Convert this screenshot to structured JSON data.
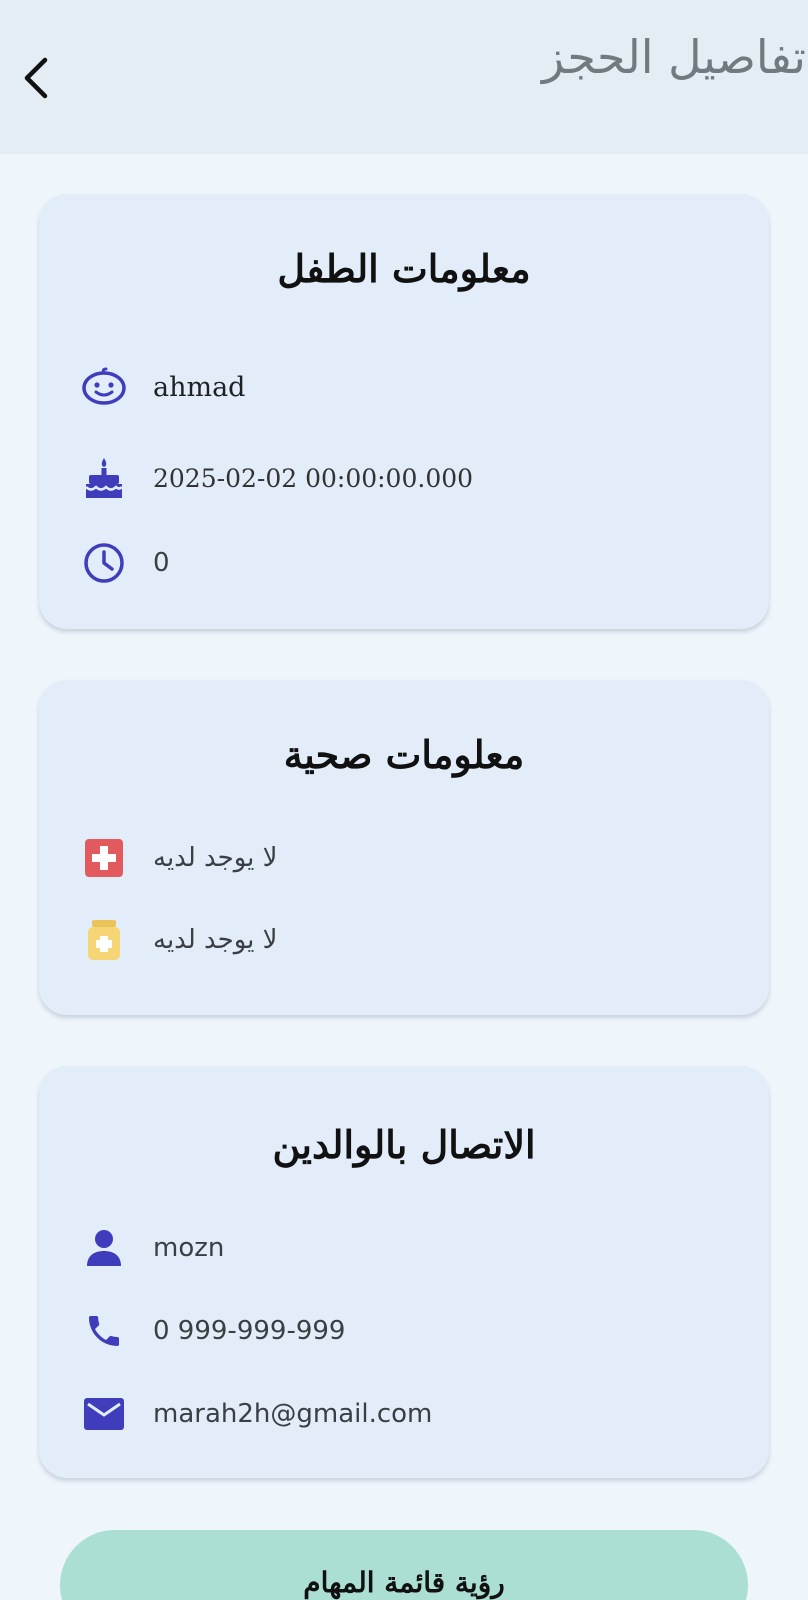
{
  "header": {
    "title": "تفاصيل الحجز",
    "back_icon": "chevron-left-icon"
  },
  "child_info": {
    "title": "معلومات الطفل",
    "name": "ahmad",
    "birth_date": "2025-02-02 00:00:00.000",
    "age": "0",
    "icons": [
      "child-face-icon",
      "birthday-cake-icon",
      "clock-icon"
    ]
  },
  "health_info": {
    "title": "معلومات صحية",
    "condition": "لا يوجد لديه",
    "medication": "لا يوجد لديه",
    "icons": [
      "medical-cross-icon",
      "medicine-bottle-icon"
    ]
  },
  "parent_contact": {
    "title": "الاتصال بالوالدين",
    "name": "mozn",
    "phone": "0 999-999-999",
    "email": "marah2h@gmail.com",
    "icons": [
      "person-icon",
      "phone-icon",
      "email-icon"
    ]
  },
  "footer": {
    "view_tasks_label": "رؤية قائمة المهام"
  },
  "colors": {
    "header_bg": "#e3edf3",
    "card_bg": "#e3edf9",
    "icon_accent": "#3f3dbb",
    "button_bg": "#abdfd3"
  }
}
